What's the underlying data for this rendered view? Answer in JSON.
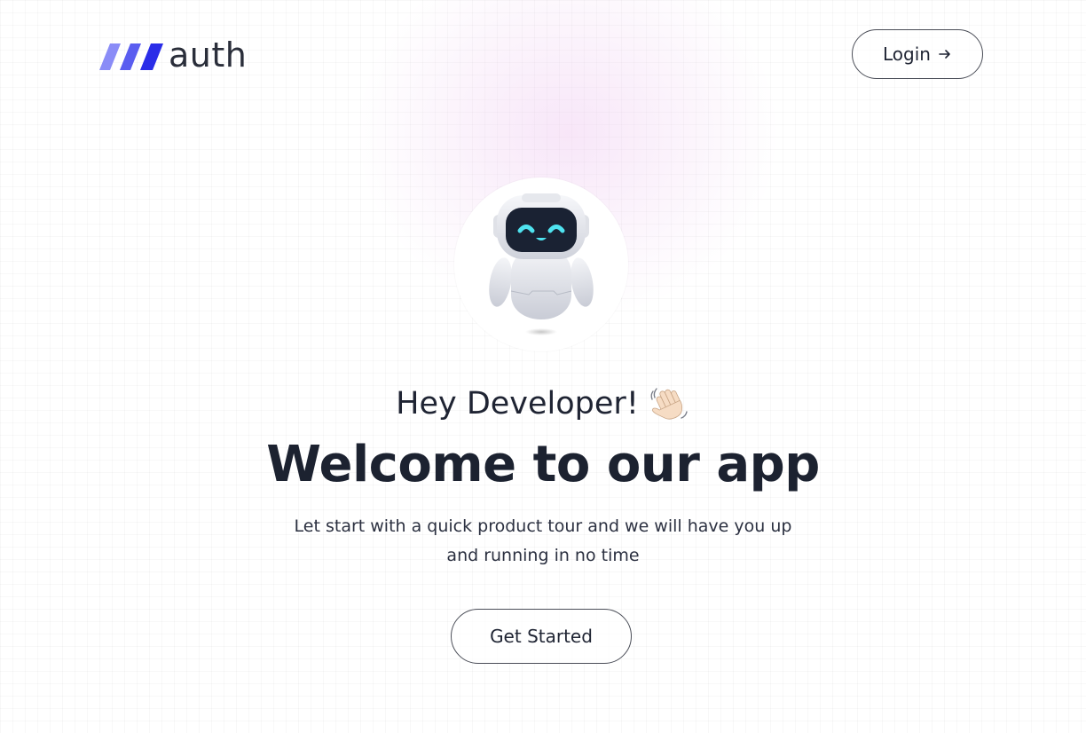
{
  "header": {
    "logo_text": "auth",
    "login_label": "Login"
  },
  "hero": {
    "greeting": "Hey Developer!",
    "headline": "Welcome to our app",
    "subtitle": "Let start with a quick product tour and we will have you up and running in no time",
    "cta_label": "Get Started"
  },
  "icons": {
    "logo": "three-slash-logo-icon",
    "login_arrow": "arrow-right-icon",
    "avatar": "robot-icon",
    "greeting": "waving-hand-icon"
  },
  "colors": {
    "logo_light": "#8a8cf7",
    "logo_mid": "#5a5df0",
    "logo_dark": "#2a2de8",
    "text": "#1f2433",
    "robot_eyes": "#4fe3f0"
  }
}
